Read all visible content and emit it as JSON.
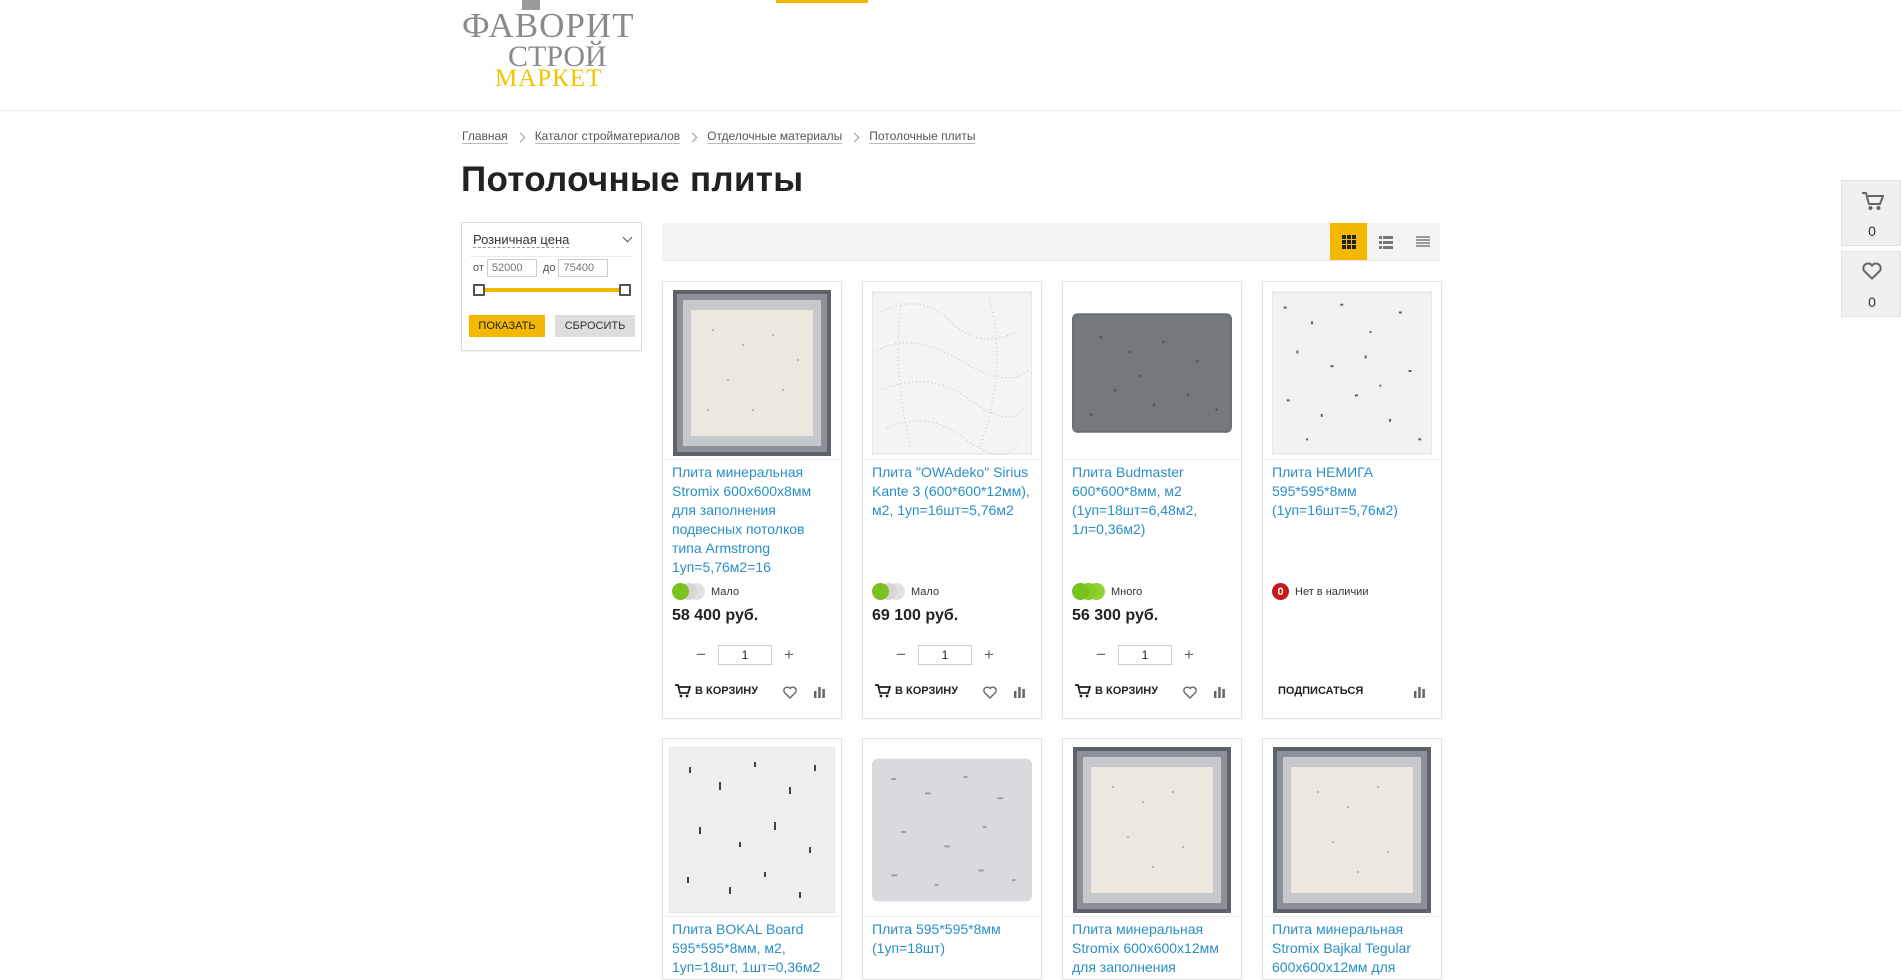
{
  "logo": {
    "line1": "ФАВОРИТ",
    "line2": "СТРОЙ",
    "line3": "МАРКЕТ"
  },
  "breadcrumbs": [
    "Главная",
    "Каталог стройматериалов",
    "Отделочные материалы",
    "Потолочные плиты"
  ],
  "page_title": "Потолочные плиты",
  "filter": {
    "title": "Розничная цена",
    "from_label": "от",
    "to_label": "до",
    "from_placeholder": "52000",
    "to_placeholder": "75400",
    "show_button": "Показать",
    "reset_button": "Сбросить"
  },
  "colors": {
    "accent": "#f5b800",
    "link": "#2a8fc6",
    "stock_green": "#7ac21f",
    "stock_red": "#c51a1a"
  },
  "view_modes": [
    "grid-view-icon",
    "list-view-icon",
    "table-view-icon"
  ],
  "labels": {
    "add_to_cart": "В корзину",
    "subscribe": "Подписаться"
  },
  "products": [
    {
      "title": "Плита минеральная Stromix 600х600х8мм для заполнения подвесных потолков типа Armstrong 1уп=5,76м2=16",
      "stock": "Мало",
      "stock_level": 1,
      "price": "58 400 руб.",
      "qty": "1",
      "available": true
    },
    {
      "title": "Плита \"OWAdeko\" Sirius Kante 3 (600*600*12мм), м2, 1уп=16шт=5,76м2",
      "stock": "Мало",
      "stock_level": 1,
      "price": "69 100 руб.",
      "qty": "1",
      "available": true
    },
    {
      "title": "Плита Budmaster 600*600*8мм, м2 (1уп=18шт=6,48м2, 1л=0,36м2)",
      "stock": "Много",
      "stock_level": 3,
      "price": "56 300 руб.",
      "qty": "1",
      "available": true
    },
    {
      "title": "Плита НЕМИГА 595*595*8мм (1уп=16шт=5,76м2)",
      "stock": "Нет в наличии",
      "stock_level": 0,
      "stock_badge": "0",
      "price": "",
      "qty": "",
      "available": false
    },
    {
      "title": "Плита BOKAL Board 595*595*8мм, м2, 1уп=18шт, 1шт=0,36м2"
    },
    {
      "title": "Плита 595*595*8мм (1уп=18шт)"
    },
    {
      "title": "Плита минеральная Stromix 600х600х12мм для заполнения"
    },
    {
      "title": "Плита минеральная Stromix Bajkal Tegular 600х600х12мм для"
    }
  ],
  "side_panel": {
    "cart_count": "0",
    "favorites_count": "0"
  }
}
